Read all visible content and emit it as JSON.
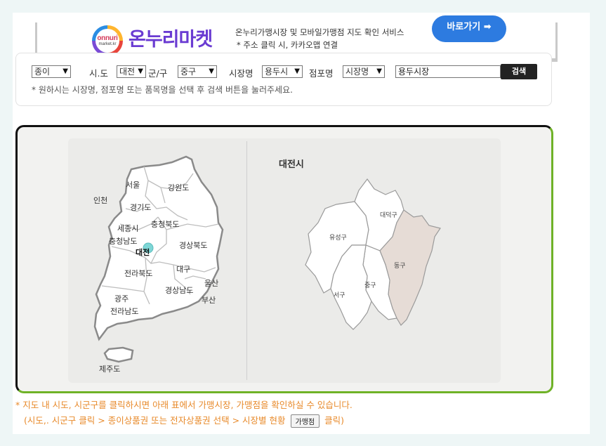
{
  "banner": {
    "logo_line1": "onnuri",
    "logo_line2": "market.kr",
    "brand_name": "온누리마켓",
    "desc_line1": "온누리가맹시장 및 모바일가맹점 지도 확인 서비스",
    "desc_line2": "* 주소 클릭 시, 카카오맵 연결",
    "goto_label": "바로가기 ➡"
  },
  "search": {
    "type_select": "종이",
    "sido_label": "시.도",
    "sido_select": "대전",
    "gungu_label": "군/구",
    "gungu_select": "중구",
    "market_label": "시장명",
    "market_select": "용두시",
    "store_label": "점포명",
    "store_select": "시장명",
    "keyword_value": "용두시장",
    "search_button": "검색",
    "hint": "* 원하시는 시장명, 점포명 또는 품목명을 선택 후 검색 버튼을 눌러주세요."
  },
  "korea_map": {
    "regions": [
      "서울",
      "강원도",
      "인천",
      "경기도",
      "세종시",
      "충청북도",
      "충청남도",
      "대전",
      "경상북도",
      "대구",
      "전라북도",
      "울산",
      "경상남도",
      "광주",
      "부산",
      "전라남도",
      "제주도"
    ],
    "selected": "대전"
  },
  "city_map": {
    "title": "대전시",
    "districts": [
      "대덕구",
      "유성구",
      "동구",
      "중구",
      "서구"
    ],
    "highlighted": "동구"
  },
  "notes": {
    "line1": "* 지도 내 시도, 시군구를 클릭하시면 아래 표에서 가맹시장, 가맹점을 확인하실 수 있습니다.",
    "line2_before": "(시도,. 시군구 클릭 > 종이상품권 또는 전자상품권 선택 > 시장별 현황",
    "line2_button": "가맹점",
    "line2_after": "클릭)"
  },
  "colors": {
    "accent_blue": "#2d7be0",
    "frame_green": "#6fb227",
    "note_orange": "#e88a2b",
    "brand_purple": "#6a3bd2",
    "highlight_district": "#e6dcd6",
    "selected_marker": "#7ed6d6"
  }
}
